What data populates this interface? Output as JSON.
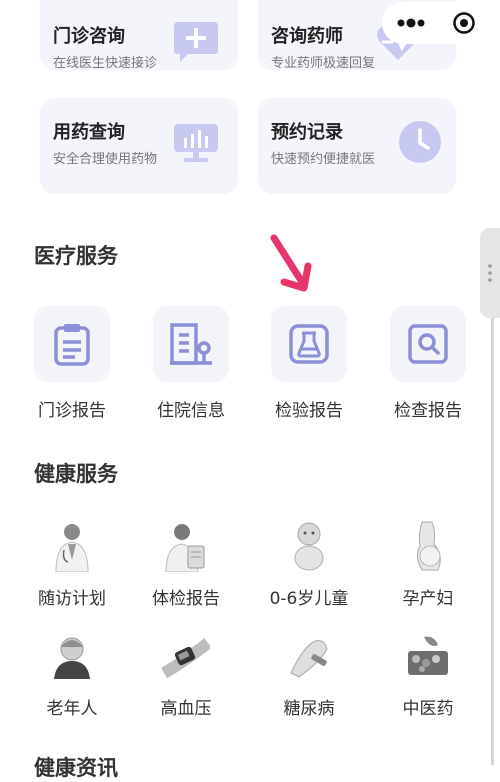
{
  "cards": [
    {
      "title": "门诊咨询",
      "subtitle": "在线医生快速接诊",
      "icon": "chat-plus-icon"
    },
    {
      "title": "咨询药师",
      "subtitle": "专业药师极速回复",
      "icon": "heart-icon"
    },
    {
      "title": "用药查询",
      "subtitle": "安全合理使用药物",
      "icon": "monitor-chart-icon"
    },
    {
      "title": "预约记录",
      "subtitle": "快速预约便捷就医",
      "icon": "clock-icon"
    }
  ],
  "medical": {
    "title": "医疗服务",
    "items": [
      {
        "label": "门诊报告",
        "icon": "clipboard-icon"
      },
      {
        "label": "住院信息",
        "icon": "building-icon"
      },
      {
        "label": "检验报告",
        "icon": "flask-icon"
      },
      {
        "label": "检查报告",
        "icon": "magnifier-icon"
      }
    ]
  },
  "health": {
    "title": "健康服务",
    "items": [
      {
        "label": "随访计划",
        "icon": "doctor-photo"
      },
      {
        "label": "体检报告",
        "icon": "doctor-clipboard-photo"
      },
      {
        "label": "0-6岁儿童",
        "icon": "baby-photo"
      },
      {
        "label": "孕产妇",
        "icon": "pregnant-photo"
      },
      {
        "label": "老年人",
        "icon": "elderly-photo"
      },
      {
        "label": "高血压",
        "icon": "blood-pressure-photo"
      },
      {
        "label": "糖尿病",
        "icon": "glucose-photo"
      },
      {
        "label": "中医药",
        "icon": "herbs-photo"
      }
    ]
  },
  "next_section": {
    "title": "健康资讯"
  },
  "colors": {
    "accent": "#8b8fd6",
    "card_bg": "#f4f4fb",
    "arrow": "#e8366a"
  }
}
